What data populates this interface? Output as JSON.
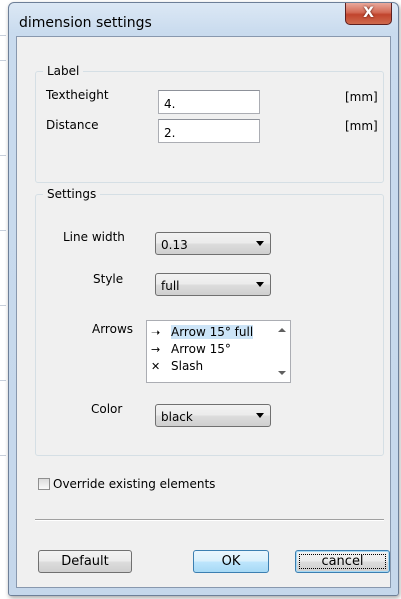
{
  "window": {
    "title": "dimension settings",
    "close_glyph": "X"
  },
  "label_group": {
    "title": "Label",
    "textheight": {
      "label": "Textheight",
      "value": "4.",
      "unit": "[mm]"
    },
    "distance": {
      "label": "Distance",
      "value": "2.",
      "unit": "[mm]"
    }
  },
  "settings_group": {
    "title": "Settings",
    "line_width": {
      "label": "Line width",
      "value": "0.13"
    },
    "style": {
      "label": "Style",
      "value": "full"
    },
    "arrows": {
      "label": "Arrows",
      "items": [
        {
          "glyph": "➝",
          "label": "Arrow 15° full",
          "selected": true
        },
        {
          "glyph": "→",
          "label": "Arrow 15°",
          "selected": false
        },
        {
          "glyph": "✕",
          "label": "Slash",
          "selected": false
        }
      ]
    },
    "color": {
      "label": "Color",
      "value": "black"
    }
  },
  "override_checkbox": {
    "label": "Override existing elements",
    "checked": false
  },
  "buttons": {
    "default": "Default",
    "ok": "OK",
    "cancel": "cancel"
  },
  "colors": {
    "title_bar": "#c9dbee",
    "close_button": "#c1442d",
    "client_bg": "#f0f0f0",
    "selection": "#cce4f7"
  }
}
